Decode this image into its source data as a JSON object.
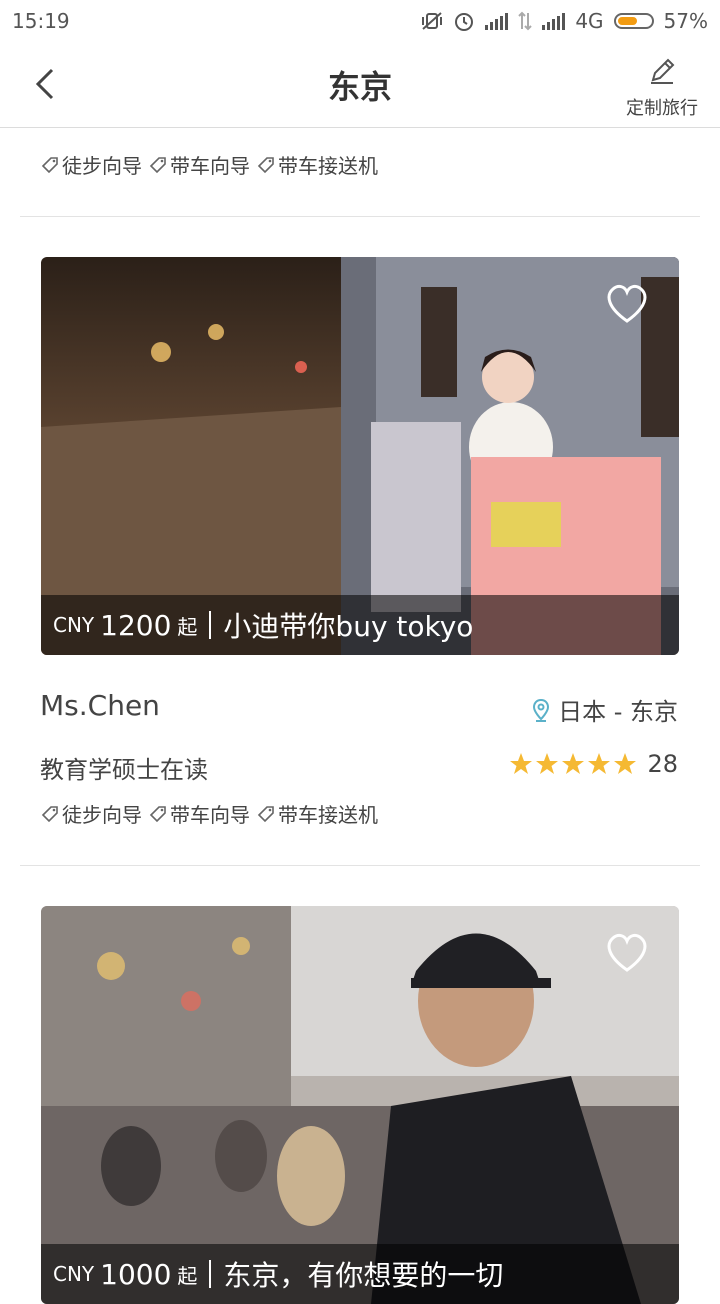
{
  "status_bar": {
    "time": "15:19",
    "network": "4G",
    "battery": "57%"
  },
  "header": {
    "title": "东京",
    "custom_trip_label": "定制旅行"
  },
  "top_tags": [
    "徒步向导",
    "带车向导",
    "带车接送机"
  ],
  "cards": [
    {
      "currency": "CNY",
      "price": "1200",
      "from": "起",
      "title": "小迪带你buy tokyo",
      "guide_name": "Ms.Chen",
      "location": "日本 - 东京",
      "degree": "教育学硕士在读",
      "rating_count": "28",
      "stars": 5,
      "tags": [
        "徒步向导",
        "带车向导",
        "带车接送机"
      ]
    },
    {
      "currency": "CNY",
      "price": "1000",
      "from": "起",
      "title": "东京，有你想要的一切"
    }
  ],
  "colors": {
    "accent": "#f5a623",
    "pin": "#5bb1c9",
    "divider": "#e3e3e3"
  }
}
